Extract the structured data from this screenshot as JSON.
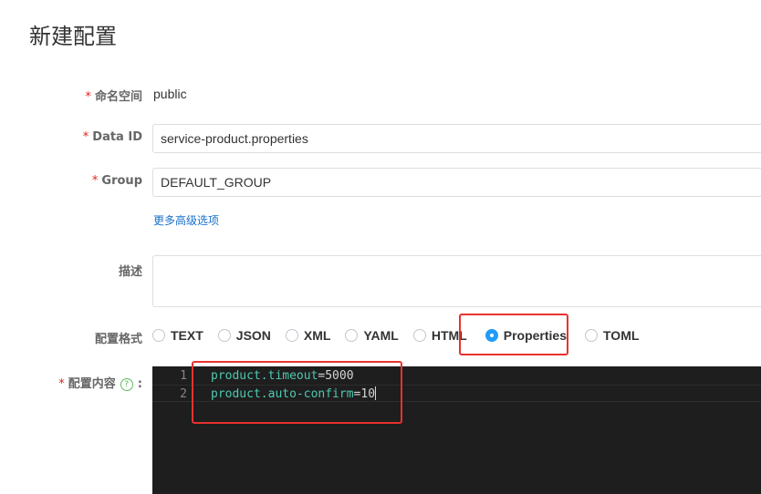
{
  "page": {
    "title": "新建配置"
  },
  "form": {
    "namespace": {
      "label": "命名空间",
      "value": "public"
    },
    "data_id": {
      "label": "Data ID",
      "value": "service-product.properties"
    },
    "group": {
      "label": "Group",
      "value": "DEFAULT_GROUP"
    },
    "advanced_link": "更多高级选项",
    "description": {
      "label": "描述",
      "value": ""
    },
    "format": {
      "label": "配置格式",
      "options": [
        "TEXT",
        "JSON",
        "XML",
        "YAML",
        "HTML",
        "Properties",
        "TOML"
      ],
      "selected": "Properties"
    },
    "content": {
      "label": "配置内容",
      "colon": ":",
      "lines": [
        {
          "num": "1",
          "key": "product.timeout",
          "eq": "=",
          "val": "5000"
        },
        {
          "num": "2",
          "key": "product.auto-confirm",
          "eq": "=",
          "val": "10"
        }
      ]
    },
    "required_mark": "*",
    "help_icon": "?"
  },
  "colors": {
    "required": "#e2231a",
    "link": "#1870c9",
    "radio_checked": "#209bfa",
    "annotation": "#e8322f"
  }
}
